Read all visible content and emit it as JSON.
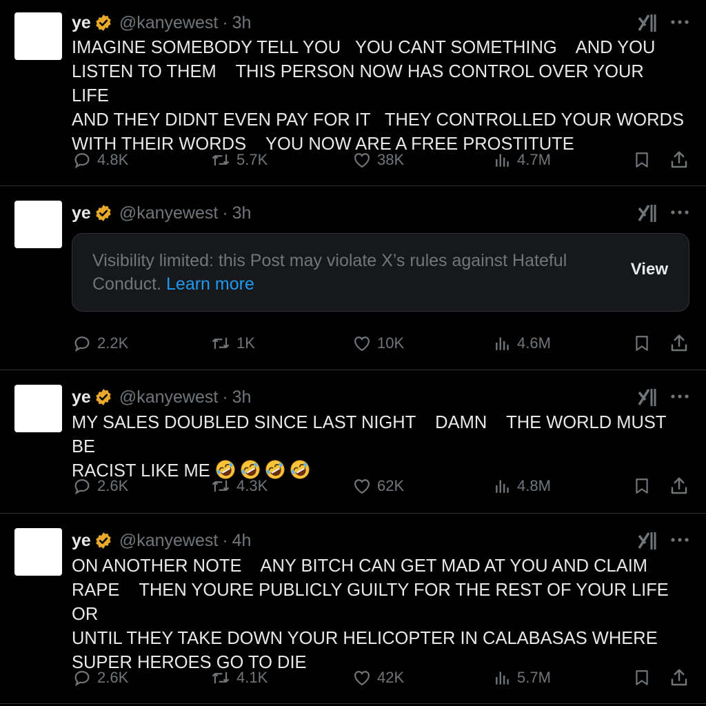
{
  "author": {
    "name": "ye",
    "handle": "@kanyewest",
    "separator": "·"
  },
  "posts": [
    {
      "time": "3h",
      "text": "IMAGINE SOMEBODY TELL YOU   YOU CANT SOMETHING    AND YOU\nLISTEN TO THEM    THIS PERSON NOW HAS CONTROL OVER YOUR LIFE\nAND THEY DIDNT EVEN PAY FOR IT   THEY CONTROLLED YOUR WORDS\nWITH THEIR WORDS    YOU NOW ARE A FREE PROSTITUTE",
      "replies": "4.8K",
      "reposts": "5.7K",
      "likes": "38K",
      "views": "4.7M"
    },
    {
      "time": "3h",
      "notice_text": "Visibility limited: this Post may violate X’s rules against Hateful Conduct.",
      "notice_link": "Learn more",
      "view_label": "View",
      "replies": "2.2K",
      "reposts": "1K",
      "likes": "10K",
      "views": "4.6M"
    },
    {
      "time": "3h",
      "text": "MY SALES DOUBLED SINCE LAST NIGHT    DAMN    THE WORLD MUST BE\nRACIST LIKE ME ",
      "emoji_count": 4,
      "replies": "2.6K",
      "reposts": "4.3K",
      "likes": "62K",
      "views": "4.8M"
    },
    {
      "time": "4h",
      "text": "ON ANOTHER NOTE    ANY BITCH CAN GET MAD AT YOU AND CLAIM\nRAPE    THEN YOURE PUBLICLY GUILTY FOR THE REST OF YOUR LIFE OR\nUNTIL THEY TAKE DOWN YOUR HELICOPTER IN CALABASAS WHERE\nSUPER HEROES GO TO DIE",
      "replies": "2.6K",
      "reposts": "4.1K",
      "likes": "42K",
      "views": "5.7M"
    }
  ],
  "icons": {
    "badge": "verified-badge-icon",
    "grok": "grok-icon",
    "more": "more-options-icon",
    "reply": "reply-icon",
    "repost": "repost-icon",
    "like": "like-icon",
    "views": "views-icon",
    "bookmark": "bookmark-icon",
    "share": "share-icon",
    "emoji": "rolling-on-floor-laughing-emoji"
  },
  "colors": {
    "background": "#000000",
    "text": "#e7e9ea",
    "muted": "#71767b",
    "link": "#1d9bf0",
    "badge": "#e8a92a",
    "divider": "#2f3336"
  }
}
